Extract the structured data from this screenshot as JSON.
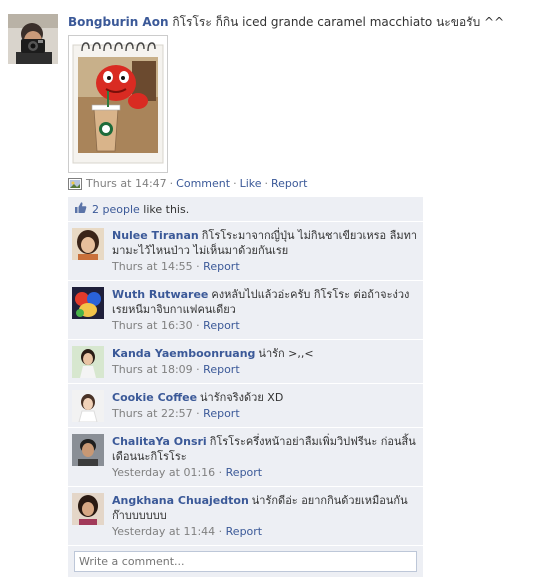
{
  "story": {
    "author": "Bongburin Aon",
    "message": "กิโรโระ ก็กิน iced grande caramel macchiato นะขอรับ ^^",
    "time": "Thurs at 14:47",
    "actions": {
      "comment": "Comment",
      "like": "Like",
      "report": "Report"
    },
    "separator": "·"
  },
  "likes": {
    "count_link": "2 people",
    "suffix": " like this."
  },
  "comments": [
    {
      "name": "Nulee Tiranan",
      "text": "กิโรโระมาจากญี่ปุ่น ไม่กินชาเขียวเหรอ ลืมทามามะไว้ไหนป่าว ไม่เห็นมาด้วยกันเรย",
      "time": "Thurs at 14:55",
      "report": "Report"
    },
    {
      "name": "Wuth Rutwaree",
      "text": "คงหลับไปแล้วอ่ะครับ กิโรโระ ต่อถ้าจะง่วงเรยหนีมาจิบกาแฟคนเดียว",
      "time": "Thurs at 16:30",
      "report": "Report"
    },
    {
      "name": "Kanda Yaemboonruang",
      "text": "น่ารัก >,,<",
      "time": "Thurs at 18:09",
      "report": "Report"
    },
    {
      "name": "Cookie Coffee",
      "text": "น่ารักจริงด้วย XD",
      "time": "Thurs at 22:57",
      "report": "Report"
    },
    {
      "name": "ChalitaYa Onsri",
      "text": "กิโรโระครึ่งหน้าอย่าลืมเพิ่มวิปฟรีนะ ก่อนสิ้นเดือนนะกิโรโระ",
      "time": "Yesterday at 01:16",
      "report": "Report"
    },
    {
      "name": "Angkhana Chuajedton",
      "text": "น่ารักดีอ่ะ อยากกินด้วยเหมือนกัน ก๊าบบบบบบ",
      "time": "Yesterday at 11:44",
      "report": "Report"
    }
  ],
  "comment_box": {
    "placeholder": "Write a comment..."
  },
  "icons": {
    "photo": "photo-icon",
    "like": "thumbs-up-icon"
  },
  "colors": {
    "link": "#3b5998",
    "feedback_bg": "#edeff4",
    "meta_text": "#808080"
  }
}
